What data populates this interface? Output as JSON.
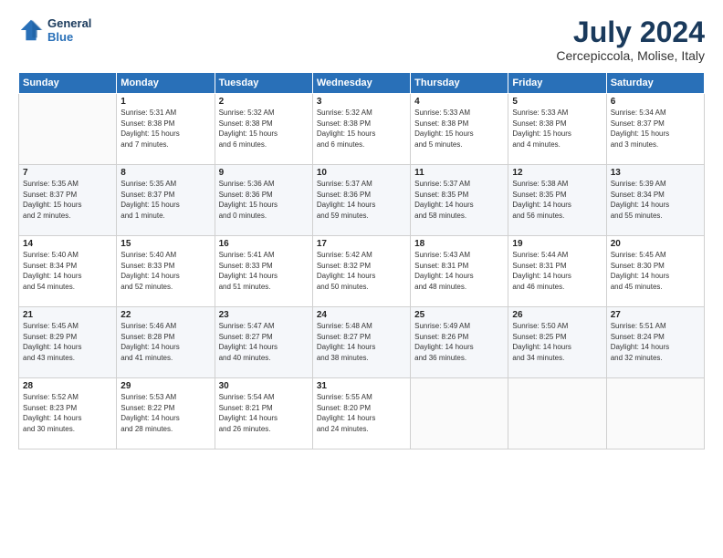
{
  "header": {
    "logo_line1": "General",
    "logo_line2": "Blue",
    "main_title": "July 2024",
    "subtitle": "Cercepiccola, Molise, Italy"
  },
  "columns": [
    "Sunday",
    "Monday",
    "Tuesday",
    "Wednesday",
    "Thursday",
    "Friday",
    "Saturday"
  ],
  "weeks": [
    [
      {
        "day": "",
        "info": ""
      },
      {
        "day": "1",
        "info": "Sunrise: 5:31 AM\nSunset: 8:38 PM\nDaylight: 15 hours\nand 7 minutes."
      },
      {
        "day": "2",
        "info": "Sunrise: 5:32 AM\nSunset: 8:38 PM\nDaylight: 15 hours\nand 6 minutes."
      },
      {
        "day": "3",
        "info": "Sunrise: 5:32 AM\nSunset: 8:38 PM\nDaylight: 15 hours\nand 6 minutes."
      },
      {
        "day": "4",
        "info": "Sunrise: 5:33 AM\nSunset: 8:38 PM\nDaylight: 15 hours\nand 5 minutes."
      },
      {
        "day": "5",
        "info": "Sunrise: 5:33 AM\nSunset: 8:38 PM\nDaylight: 15 hours\nand 4 minutes."
      },
      {
        "day": "6",
        "info": "Sunrise: 5:34 AM\nSunset: 8:37 PM\nDaylight: 15 hours\nand 3 minutes."
      }
    ],
    [
      {
        "day": "7",
        "info": "Sunrise: 5:35 AM\nSunset: 8:37 PM\nDaylight: 15 hours\nand 2 minutes."
      },
      {
        "day": "8",
        "info": "Sunrise: 5:35 AM\nSunset: 8:37 PM\nDaylight: 15 hours\nand 1 minute."
      },
      {
        "day": "9",
        "info": "Sunrise: 5:36 AM\nSunset: 8:36 PM\nDaylight: 15 hours\nand 0 minutes."
      },
      {
        "day": "10",
        "info": "Sunrise: 5:37 AM\nSunset: 8:36 PM\nDaylight: 14 hours\nand 59 minutes."
      },
      {
        "day": "11",
        "info": "Sunrise: 5:37 AM\nSunset: 8:35 PM\nDaylight: 14 hours\nand 58 minutes."
      },
      {
        "day": "12",
        "info": "Sunrise: 5:38 AM\nSunset: 8:35 PM\nDaylight: 14 hours\nand 56 minutes."
      },
      {
        "day": "13",
        "info": "Sunrise: 5:39 AM\nSunset: 8:34 PM\nDaylight: 14 hours\nand 55 minutes."
      }
    ],
    [
      {
        "day": "14",
        "info": "Sunrise: 5:40 AM\nSunset: 8:34 PM\nDaylight: 14 hours\nand 54 minutes."
      },
      {
        "day": "15",
        "info": "Sunrise: 5:40 AM\nSunset: 8:33 PM\nDaylight: 14 hours\nand 52 minutes."
      },
      {
        "day": "16",
        "info": "Sunrise: 5:41 AM\nSunset: 8:33 PM\nDaylight: 14 hours\nand 51 minutes."
      },
      {
        "day": "17",
        "info": "Sunrise: 5:42 AM\nSunset: 8:32 PM\nDaylight: 14 hours\nand 50 minutes."
      },
      {
        "day": "18",
        "info": "Sunrise: 5:43 AM\nSunset: 8:31 PM\nDaylight: 14 hours\nand 48 minutes."
      },
      {
        "day": "19",
        "info": "Sunrise: 5:44 AM\nSunset: 8:31 PM\nDaylight: 14 hours\nand 46 minutes."
      },
      {
        "day": "20",
        "info": "Sunrise: 5:45 AM\nSunset: 8:30 PM\nDaylight: 14 hours\nand 45 minutes."
      }
    ],
    [
      {
        "day": "21",
        "info": "Sunrise: 5:45 AM\nSunset: 8:29 PM\nDaylight: 14 hours\nand 43 minutes."
      },
      {
        "day": "22",
        "info": "Sunrise: 5:46 AM\nSunset: 8:28 PM\nDaylight: 14 hours\nand 41 minutes."
      },
      {
        "day": "23",
        "info": "Sunrise: 5:47 AM\nSunset: 8:27 PM\nDaylight: 14 hours\nand 40 minutes."
      },
      {
        "day": "24",
        "info": "Sunrise: 5:48 AM\nSunset: 8:27 PM\nDaylight: 14 hours\nand 38 minutes."
      },
      {
        "day": "25",
        "info": "Sunrise: 5:49 AM\nSunset: 8:26 PM\nDaylight: 14 hours\nand 36 minutes."
      },
      {
        "day": "26",
        "info": "Sunrise: 5:50 AM\nSunset: 8:25 PM\nDaylight: 14 hours\nand 34 minutes."
      },
      {
        "day": "27",
        "info": "Sunrise: 5:51 AM\nSunset: 8:24 PM\nDaylight: 14 hours\nand 32 minutes."
      }
    ],
    [
      {
        "day": "28",
        "info": "Sunrise: 5:52 AM\nSunset: 8:23 PM\nDaylight: 14 hours\nand 30 minutes."
      },
      {
        "day": "29",
        "info": "Sunrise: 5:53 AM\nSunset: 8:22 PM\nDaylight: 14 hours\nand 28 minutes."
      },
      {
        "day": "30",
        "info": "Sunrise: 5:54 AM\nSunset: 8:21 PM\nDaylight: 14 hours\nand 26 minutes."
      },
      {
        "day": "31",
        "info": "Sunrise: 5:55 AM\nSunset: 8:20 PM\nDaylight: 14 hours\nand 24 minutes."
      },
      {
        "day": "",
        "info": ""
      },
      {
        "day": "",
        "info": ""
      },
      {
        "day": "",
        "info": ""
      }
    ]
  ]
}
